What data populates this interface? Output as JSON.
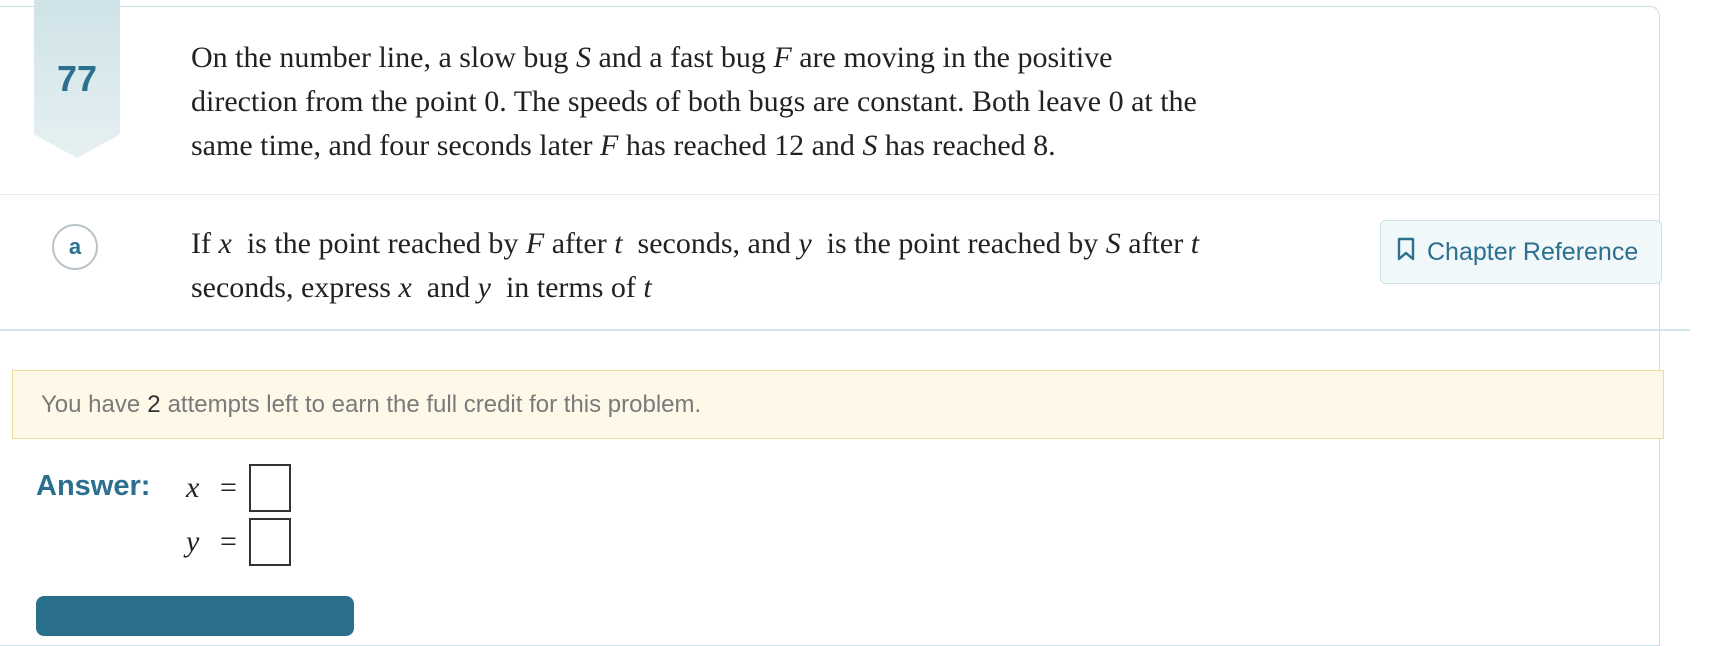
{
  "problem": {
    "number": "77",
    "text_lines": [
      [
        "On the number line, a slow bug ",
        {
          "i": "S"
        },
        " and a fast bug ",
        {
          "i": "F"
        },
        " are moving in the positive"
      ],
      [
        "direction from the point 0. The speeds of both bugs are constant. Both leave 0 at the"
      ],
      [
        "same time, and four seconds later ",
        {
          "i": "F"
        },
        " has reached 12 and ",
        {
          "i": "S"
        },
        " has reached 8."
      ]
    ]
  },
  "part": {
    "label": "a",
    "text_lines": [
      [
        "If ",
        {
          "i": "x"
        },
        "  is the point reached by ",
        {
          "i": "F"
        },
        " after ",
        {
          "i": "t"
        },
        "  seconds, and ",
        {
          "i": "y"
        },
        "  is the point reached by ",
        {
          "i": "S"
        },
        " after ",
        {
          "i": "t"
        }
      ],
      [
        "seconds, express ",
        {
          "i": "x"
        },
        "  and ",
        {
          "i": "y"
        },
        "  in terms of ",
        {
          "i": "t"
        }
      ]
    ],
    "chapter_reference_label": "Chapter Reference"
  },
  "notice": {
    "before": "You have",
    "count": "2",
    "after": "attempts left to earn the full credit for this problem."
  },
  "answer": {
    "label": "Answer:",
    "rows": [
      {
        "var": "x",
        "eq": "=",
        "value": ""
      },
      {
        "var": "y",
        "eq": "=",
        "value": ""
      }
    ]
  },
  "colors": {
    "accent": "#2c6f8f",
    "notice_bg": "#fdf8e8",
    "notice_border": "#f2dc9c"
  }
}
